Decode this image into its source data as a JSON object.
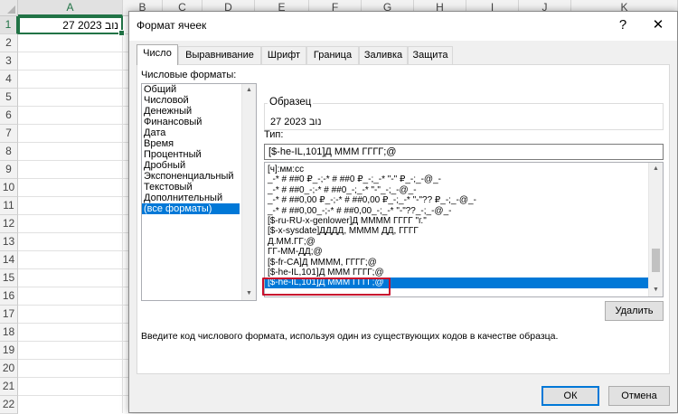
{
  "sheet": {
    "columns": [
      "A",
      "B",
      "C",
      "D",
      "E",
      "F",
      "G",
      "H",
      "I",
      "J",
      "K"
    ],
    "rows": [
      "1",
      "2",
      "3",
      "4",
      "5",
      "6",
      "7",
      "8",
      "9",
      "10",
      "11",
      "12",
      "13",
      "14",
      "15",
      "16",
      "17",
      "18",
      "19",
      "20",
      "21",
      "22"
    ],
    "a1_value": "27 נוב 2023"
  },
  "dialog": {
    "title": "Формат ячеек",
    "help": "?",
    "close": "✕",
    "tabs": [
      "Число",
      "Выравнивание",
      "Шрифт",
      "Граница",
      "Заливка",
      "Защита"
    ],
    "categories_label": "Числовые форматы:",
    "categories": [
      "Общий",
      "Числовой",
      "Денежный",
      "Финансовый",
      "Дата",
      "Время",
      "Процентный",
      "Дробный",
      "Экспоненциальный",
      "Текстовый",
      "Дополнительный",
      "(все форматы)"
    ],
    "sample_label": "Образец",
    "sample_value": "27 נוב 2023",
    "type_label": "Тип:",
    "type_value": "[$-he-IL,101]Д МММ ГГГГ;@",
    "formats": [
      "[ч]:мм:сс",
      "_-* # ##0 ₽_-;-* # ##0 ₽_-;_-* \"-\" ₽_-;_-@_-",
      "_-* # ##0_-;-* # ##0_-;_-* \"-\"_-;_-@_-",
      "_-* # ##0,00 ₽_-;-* # ##0,00 ₽_-;_-* \"-\"?? ₽_-;_-@_-",
      "_-* # ##0,00_-;-* # ##0,00_-;_-* \"-\"??_-;_-@_-",
      "[$-ru-RU-x-genlower]Д ММММ ГГГГ \"г.\"",
      "[$-x-sysdate]ДДДД, ММММ ДД, ГГГГ",
      "Д.ММ.ГГ;@",
      "ГГ-ММ-ДД;@",
      "[$-fr-CA]Д ММММ, ГГГГ;@",
      "[$-he-IL,101]Д МММ ГГГГ;@",
      "[$-he-IL,101]Д МММ ГГГГ;@"
    ],
    "delete_label": "Удалить",
    "hint": "Введите код числового формата, используя один из существующих кодов в качестве образца.",
    "ok_label": "ОК",
    "cancel_label": "Отмена"
  },
  "colors": {
    "excel_green": "#217346",
    "selection_blue": "#0078d7",
    "highlight_red": "#c8102e"
  }
}
